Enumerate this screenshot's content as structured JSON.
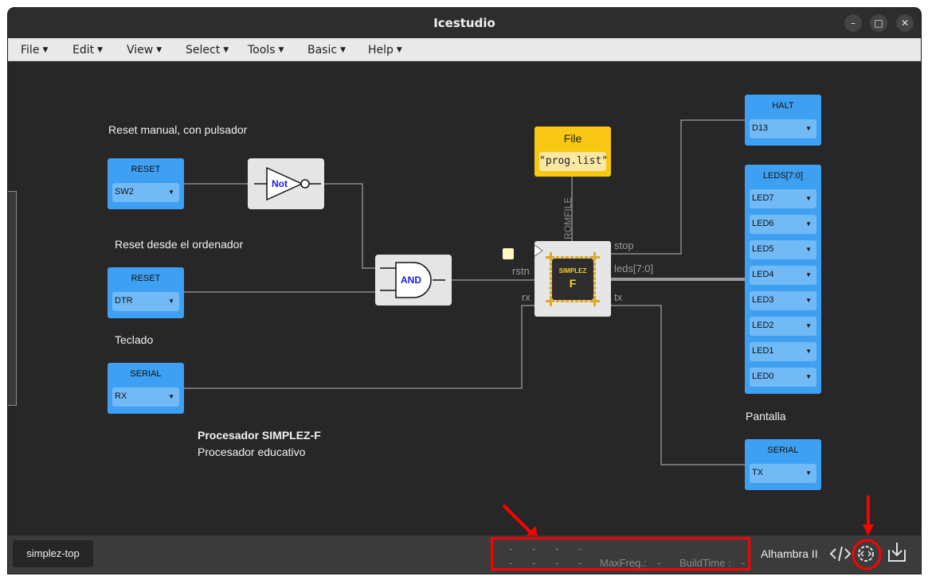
{
  "window": {
    "title": "Icestudio",
    "minimize": "–",
    "maximize": "□",
    "close": "✕"
  },
  "menu": [
    {
      "label": "File"
    },
    {
      "label": "Edit"
    },
    {
      "label": "View"
    },
    {
      "label": "Select"
    },
    {
      "label": "Tools"
    },
    {
      "label": "Basic"
    },
    {
      "label": "Help"
    }
  ],
  "canvas": {
    "comments": {
      "reset_manual": "Reset manual, con pulsador",
      "reset_pc": "Reset desde el ordenador",
      "keyboard": "Teclado",
      "screen": "Pantalla",
      "proc_title": "Procesador SIMPLEZ-F",
      "proc_desc": "Procesador educativo"
    },
    "inputs": [
      {
        "name": "RESET",
        "pin": "SW2"
      },
      {
        "name": "RESET",
        "pin": "DTR"
      },
      {
        "name": "SERIAL",
        "pin": "RX"
      }
    ],
    "gates": {
      "not": "Not",
      "and": "AND"
    },
    "file": {
      "title": "File",
      "value": "\"prog.list\""
    },
    "chip": {
      "line1": "SIMPLEZ",
      "line2": "F",
      "romfile": "ROMFILE",
      "ports": {
        "rstn": "rstn",
        "rx": "rx",
        "stop": "stop",
        "leds": "leds[7:0]",
        "tx": "tx"
      }
    },
    "outputs": {
      "halt": {
        "name": "HALT",
        "pin": "D13"
      },
      "leds": {
        "name": "LEDS[7:0]",
        "pins": [
          "LED7",
          "LED6",
          "LED5",
          "LED4",
          "LED3",
          "LED2",
          "LED1",
          "LED0"
        ]
      },
      "serial": {
        "name": "SERIAL",
        "pin": "TX"
      }
    }
  },
  "footer": {
    "tab": "simplez-top",
    "status_row1": [
      "-",
      "-",
      "-",
      "-"
    ],
    "status_row2": [
      "-",
      "-",
      "-",
      "-"
    ],
    "maxfreq_label": "MaxFreq.:",
    "maxfreq_value": "-",
    "buildtime_label": "BuildTime :",
    "buildtime_value": "-",
    "board": "Alhambra II",
    "icons": [
      "code-icon",
      "settings-code-icon",
      "upload-icon"
    ]
  },
  "colors": {
    "block_blue": "#3ea0f2",
    "file_yellow": "#f8c714",
    "annotation_red": "#ff0000"
  }
}
